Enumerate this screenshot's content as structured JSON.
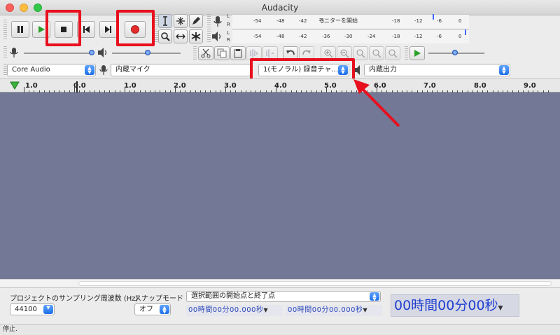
{
  "window": {
    "title": "Audacity"
  },
  "meters": {
    "record_prompt": "モニターを開始",
    "channel_left": "L",
    "channel_right": "R",
    "record_scale": [
      "-54",
      "-48",
      "-42",
      "-3",
      "-18",
      "-12",
      "-6",
      "0"
    ],
    "play_scale": [
      "-54",
      "-48",
      "-42",
      "-36",
      "-30",
      "-24",
      "-18",
      "-12",
      "-6",
      "0"
    ]
  },
  "device": {
    "host": "Core Audio",
    "input": "内蔵マイク",
    "channels": "1(モノラル) 録音チャ…",
    "output": "内蔵出力"
  },
  "ruler": {
    "labels": [
      "1.0",
      "0.0",
      "1.0",
      "2.0",
      "3.0",
      "4.0",
      "5.0",
      "6.0",
      "7.0",
      "8.0",
      "9.0"
    ]
  },
  "selection": {
    "rate_label": "プロジェクトのサンプリング周波数 (Hz)",
    "rate_value": "44100",
    "snap_label": "スナップモード",
    "snap_value": "オフ",
    "range_mode": "選択範囲の開始点と終了点",
    "start_time": "00時間00分00.000秒",
    "end_time": "00時間00分00.000秒",
    "audio_position": "00時間00分00秒"
  },
  "status": {
    "text": "停止."
  },
  "colors": {
    "highlight": "#e8101e",
    "track_bg": "#737896",
    "time_text": "#1f3fd0"
  }
}
